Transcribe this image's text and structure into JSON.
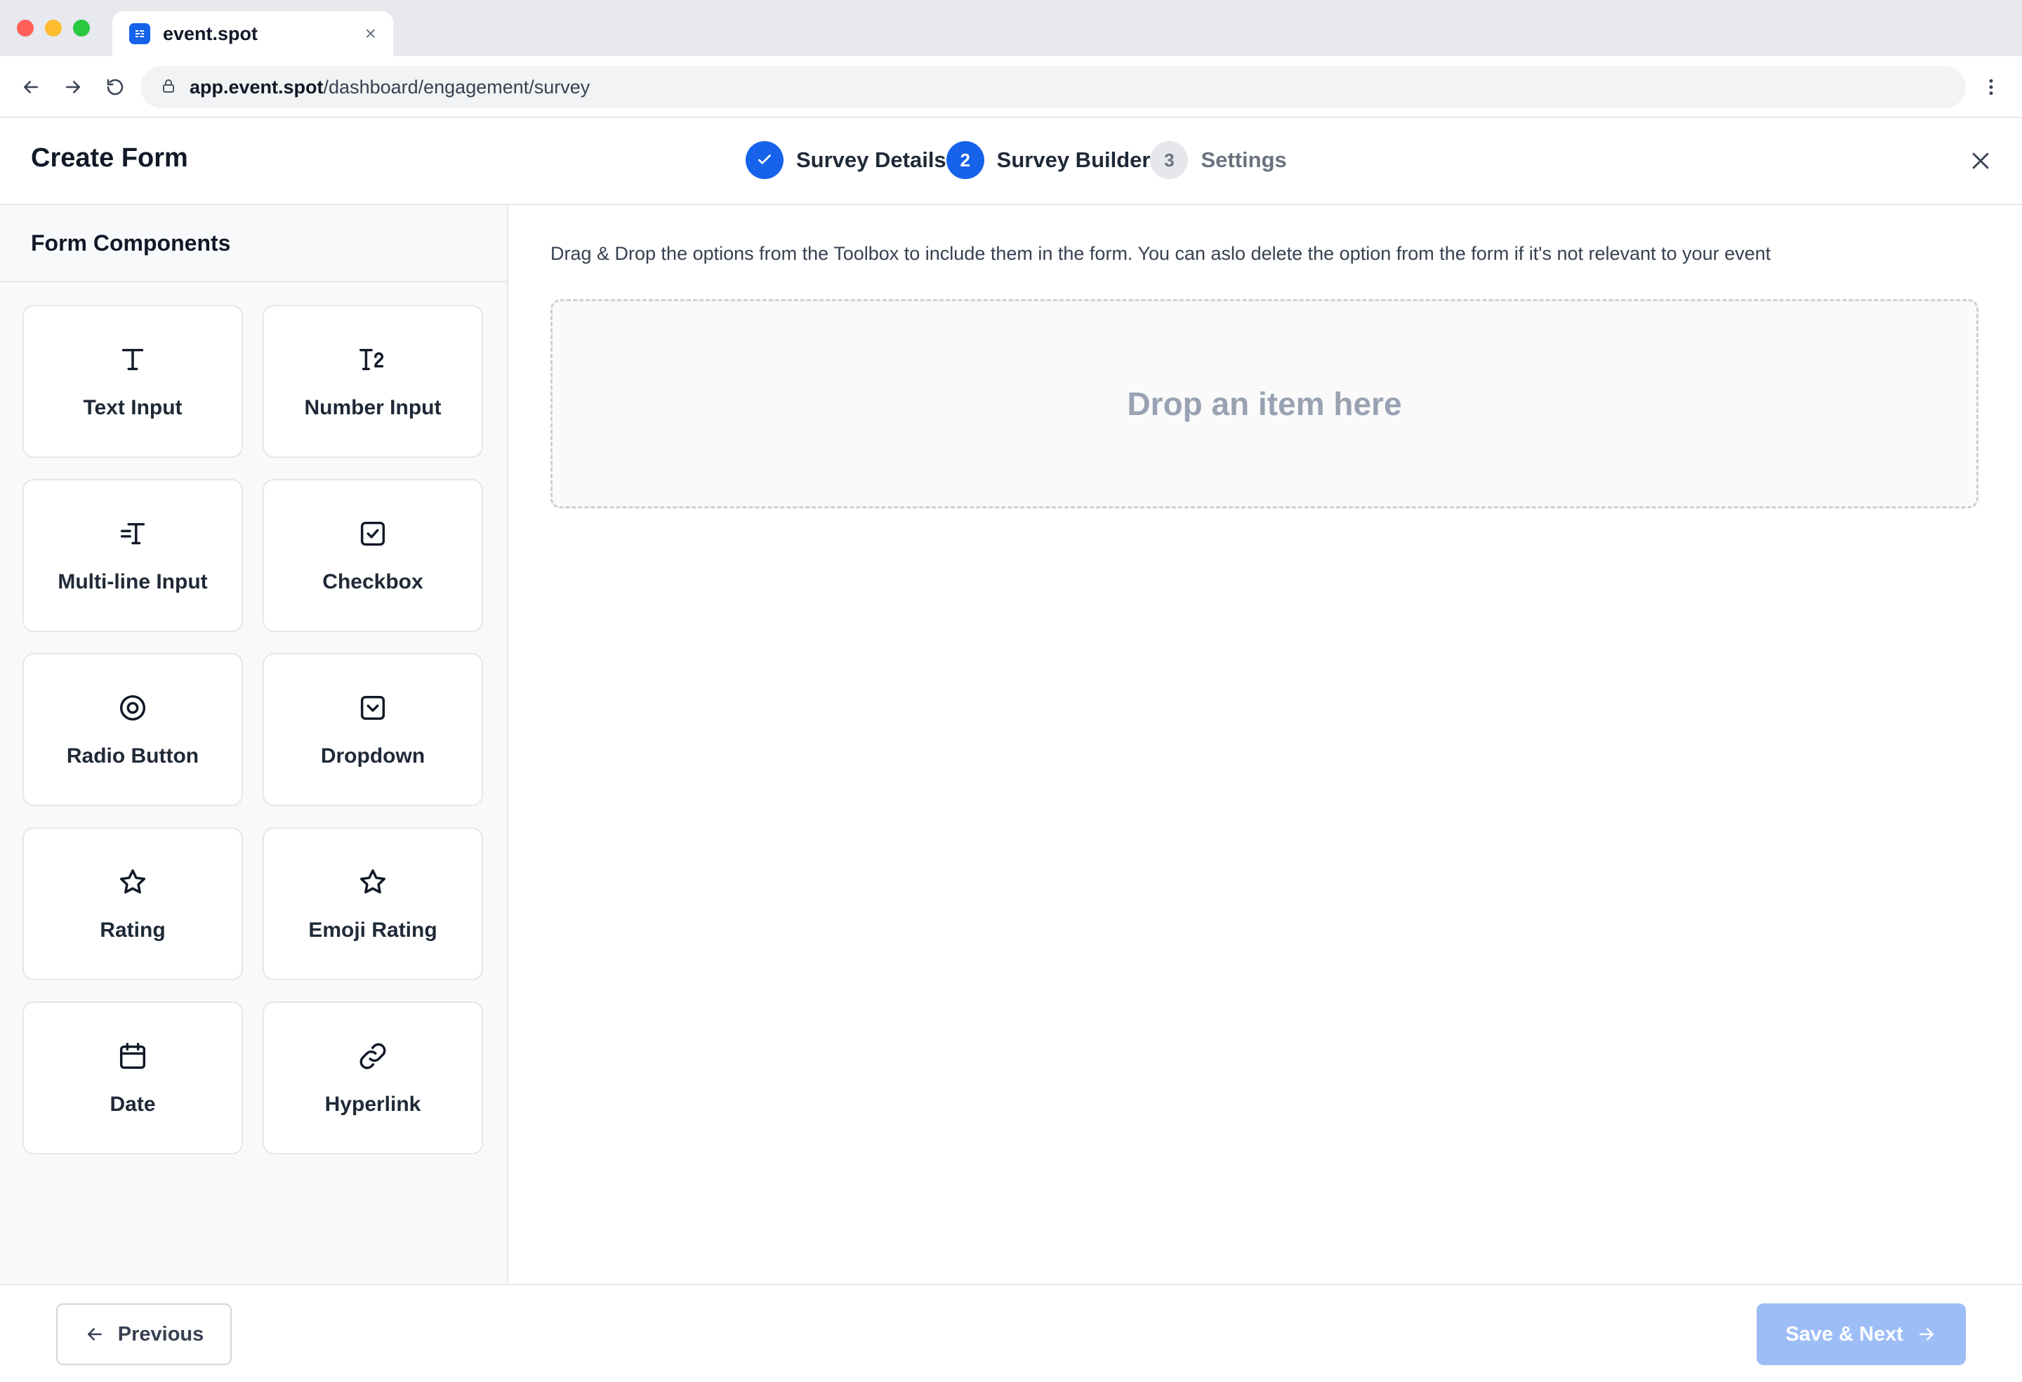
{
  "browser": {
    "tab_title": "event.spot",
    "tab_close": "×",
    "url_host": "app.event.spot",
    "url_path": "/dashboard/engagement/survey"
  },
  "header": {
    "title": "Create Form",
    "steps": [
      {
        "number": "1",
        "label": "Survey Details",
        "state": "done"
      },
      {
        "number": "2",
        "label": "Survey Builder",
        "state": "active"
      },
      {
        "number": "3",
        "label": "Settings",
        "state": "todo"
      }
    ]
  },
  "sidebar": {
    "title": "Form Components",
    "components": [
      {
        "label": "Text Input",
        "icon": "text-input-icon"
      },
      {
        "label": "Number Input",
        "icon": "number-input-icon"
      },
      {
        "label": "Multi-line Input",
        "icon": "multiline-input-icon"
      },
      {
        "label": "Checkbox",
        "icon": "checkbox-icon"
      },
      {
        "label": "Radio Button",
        "icon": "radio-button-icon"
      },
      {
        "label": "Dropdown",
        "icon": "dropdown-icon"
      },
      {
        "label": "Rating",
        "icon": "star-icon"
      },
      {
        "label": "Emoji Rating",
        "icon": "star-icon"
      },
      {
        "label": "Date",
        "icon": "calendar-icon"
      },
      {
        "label": "Hyperlink",
        "icon": "link-icon"
      }
    ]
  },
  "main": {
    "instructions": "Drag & Drop the options from the Toolbox to include them in the form. You can aslo delete the option from the form if it's not relevant to your event",
    "dropzone_text": "Drop an item here"
  },
  "footer": {
    "previous_label": "Previous",
    "next_label": "Save & Next"
  },
  "colors": {
    "primary": "#1762ea",
    "primary_disabled": "#9dbdf7"
  }
}
